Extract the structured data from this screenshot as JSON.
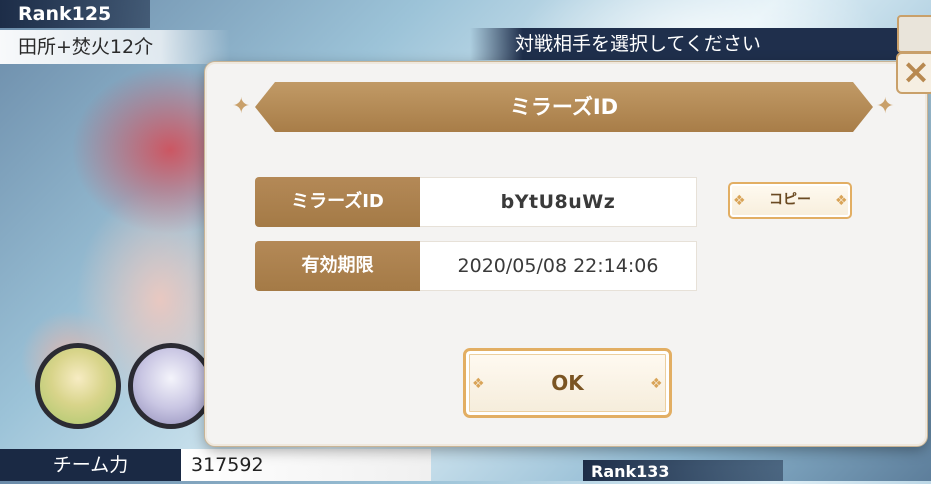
{
  "background": {
    "rank_top": "Rank125",
    "player_name": "田所+焚火12介",
    "select_banner": "対戦相手を選択してください",
    "team_power_label": "チーム力",
    "team_power_value": "317592",
    "rank_bottom": "Rank133"
  },
  "modal": {
    "title": "ミラーズID",
    "close_icon": "×",
    "rows": [
      {
        "label": "ミラーズID",
        "value": "bYtU8uWz"
      },
      {
        "label": "有効期限",
        "value": "2020/05/08 22:14:06"
      }
    ],
    "copy_button": "コピー",
    "ok_button": "OK"
  },
  "colors": {
    "accent_gold": "#a87d48",
    "button_border": "#e2ae63",
    "navy_bar": "#1a2944"
  }
}
